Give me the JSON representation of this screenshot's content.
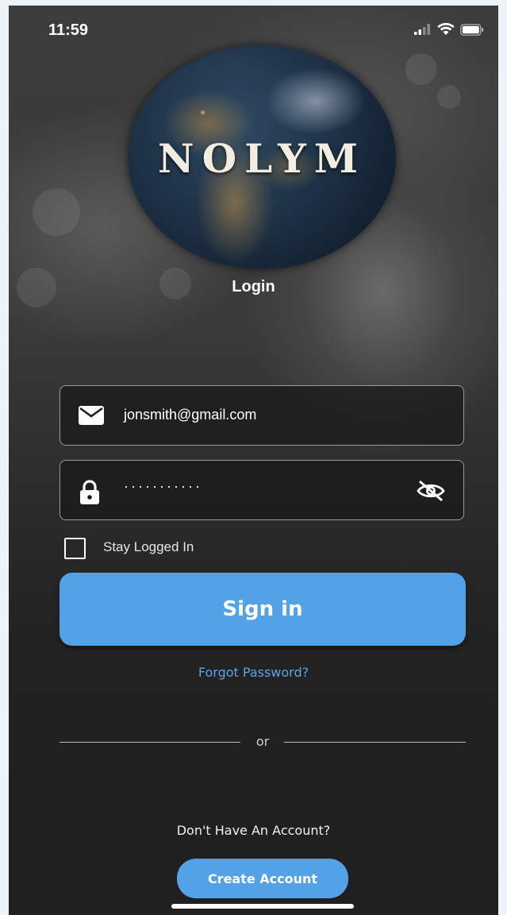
{
  "status_bar": {
    "time": "11:59"
  },
  "logo": {
    "text": "NOLYM"
  },
  "title": "Login",
  "email": {
    "value": "jonsmith@gmail.com",
    "icon": "mail-icon"
  },
  "password": {
    "value": "···········",
    "icon": "lock-icon",
    "toggle_icon": "eye-off-icon"
  },
  "stay_logged_in": {
    "label": "Stay Logged In",
    "checked": false
  },
  "sign_in_label": "Sign in",
  "forgot_label": "Forgot Password?",
  "divider_label": "or",
  "no_account_label": "Don't Have An Account?",
  "create_account_label": "Create Account",
  "colors": {
    "accent": "#53a2e8",
    "link": "#5aa6ea",
    "background": "#2b2b2b"
  }
}
